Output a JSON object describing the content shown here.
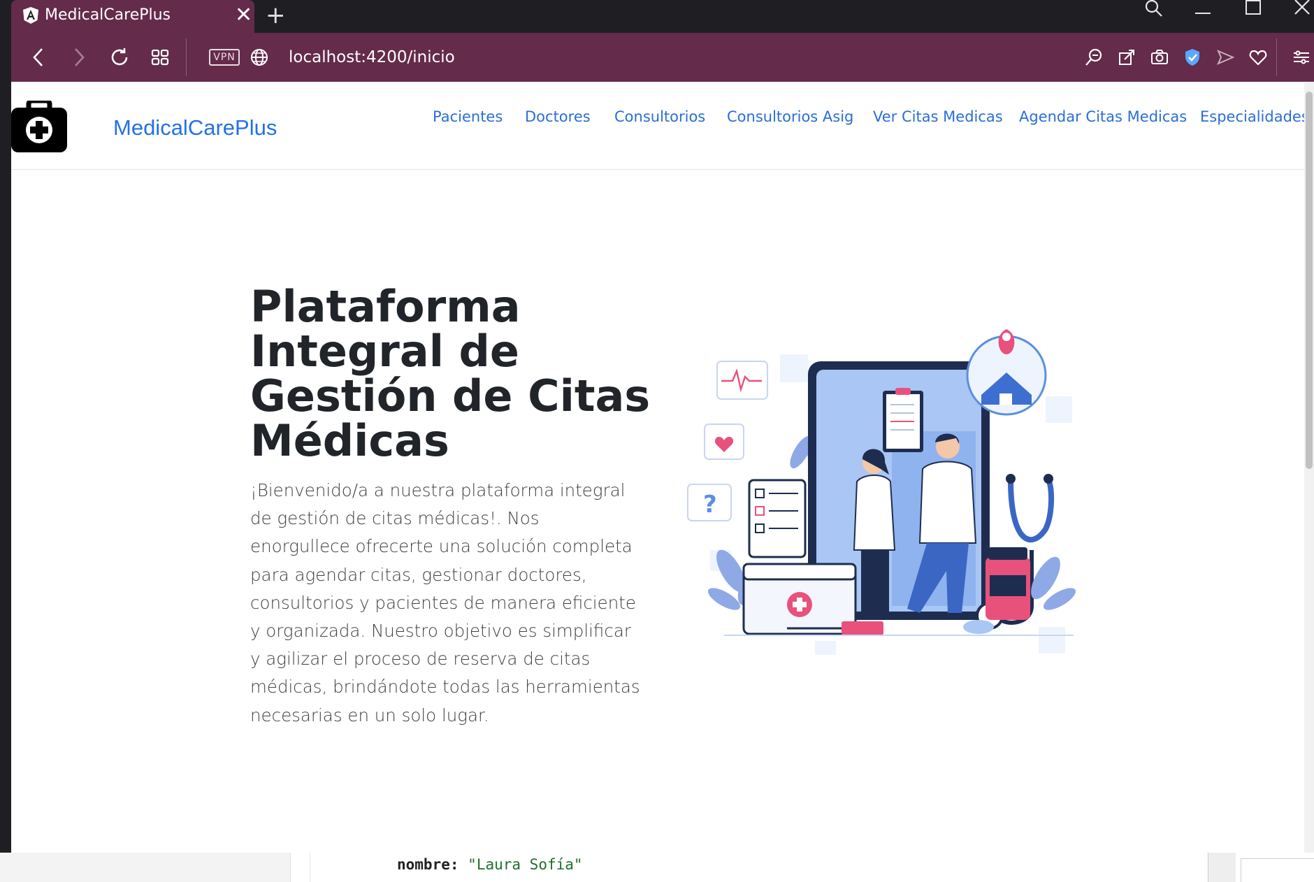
{
  "browser": {
    "tab_title": "MedicalCarePlus",
    "url_host": "localhost",
    "url_rest": ":4200/inicio",
    "vpn_label": "VPN",
    "accent_color": "#642b4b"
  },
  "navbar": {
    "brand": "MedicalCarePlus",
    "links": [
      "Pacientes",
      "Doctores",
      "Consultorios",
      "Consultorios Asig",
      "Ver Citas Medicas",
      "Agendar Citas Medicas",
      "Especialidades"
    ],
    "link_color": "#2a6ed6"
  },
  "hero": {
    "title_lines": [
      "Plataforma",
      "Integral de",
      "Gestión de Citas",
      "Médicas"
    ],
    "text": "¡Bienvenido/a a nuestra plataforma integral de gestión de citas médicas!. Nos enorgullece ofrecerte una solución completa para agendar citas, gestionar doctores, consultorios y pacientes de manera eficiente y organizada. Nuestro objetivo es simplificar y agilizar el proceso de reserva de citas médicas, brindándote todas las herramientas necesarias en un solo lugar."
  },
  "editor": {
    "key": "nombre:",
    "value": "\"Laura Sofía\""
  }
}
